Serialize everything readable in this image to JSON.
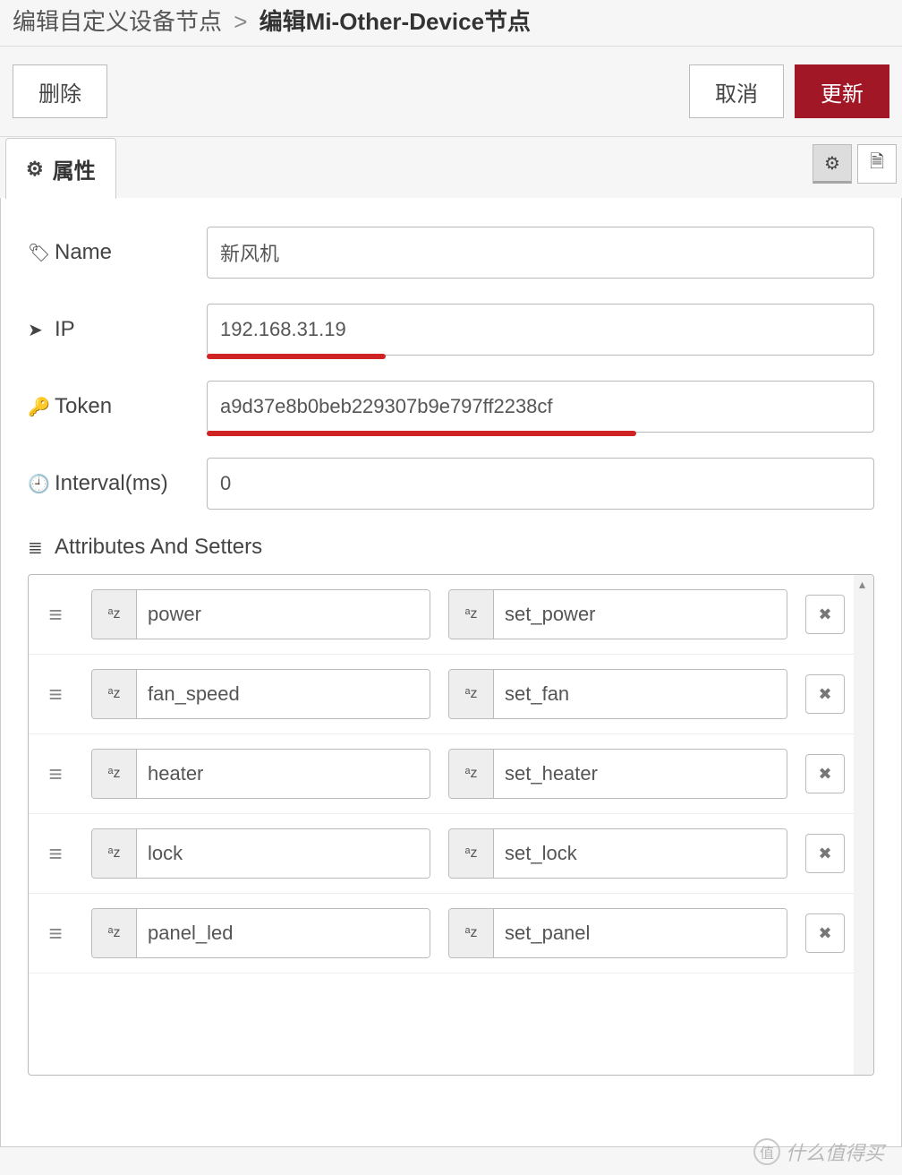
{
  "breadcrumb": {
    "parent": "编辑自定义设备节点",
    "sep": ">",
    "current": "编辑Mi-Other-Device节点"
  },
  "actions": {
    "delete": "删除",
    "cancel": "取消",
    "update": "更新"
  },
  "tabs": {
    "properties_label": "属性"
  },
  "form": {
    "name_label": "Name",
    "name_value": "新风机",
    "ip_label": "IP",
    "ip_value": "192.168.31.19",
    "token_label": "Token",
    "token_value": "a9d37e8b0beb229307b9e797ff2238cf",
    "interval_label": "Interval(ms)",
    "interval_value": "0"
  },
  "section": {
    "attrs_label": "Attributes And Setters"
  },
  "rows": [
    {
      "attr": "power",
      "setter": "set_power"
    },
    {
      "attr": "fan_speed",
      "setter": "set_fan"
    },
    {
      "attr": "heater",
      "setter": "set_heater"
    },
    {
      "attr": "lock",
      "setter": "set_lock"
    },
    {
      "attr": "panel_led",
      "setter": "set_panel"
    }
  ],
  "icons": {
    "gear": "⚙",
    "doc": "🗎",
    "tag": "🏷",
    "arrow": "➤",
    "key": "🔑",
    "clock": "🕘",
    "bars": "≣",
    "drag": "≡",
    "az": "ᵃz",
    "close": "✖",
    "scrollup": "▴"
  },
  "watermark": {
    "badge": "值",
    "text": "什么值得买"
  }
}
